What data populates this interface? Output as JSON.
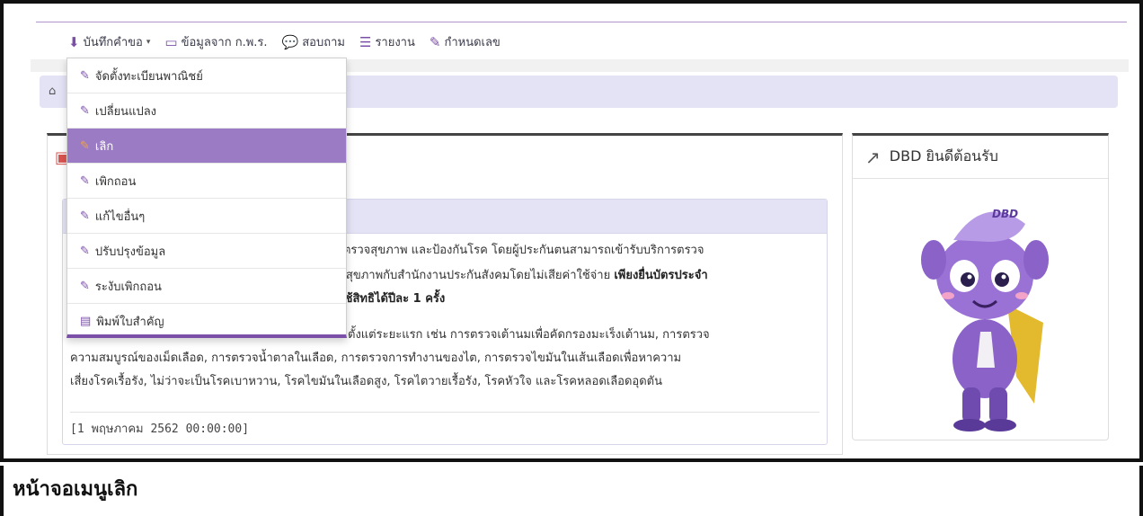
{
  "navbar": {
    "items": [
      {
        "icon": "download-icon",
        "glyph": "⬇",
        "label": "บันทึกคำขอ",
        "caret": "▾"
      },
      {
        "icon": "monitor-icon",
        "glyph": "▭",
        "label": "ข้อมูลจาก ก.พ.ร."
      },
      {
        "icon": "chat-icon",
        "glyph": "💬",
        "label": "สอบถาม"
      },
      {
        "icon": "document-icon",
        "glyph": "☰",
        "label": "รายงาน"
      },
      {
        "icon": "edit-icon",
        "glyph": "✎",
        "label": "กำหนดเลข"
      }
    ]
  },
  "breadcrumb": {
    "icon": "home-icon",
    "glyph": "⌂"
  },
  "dropdown": {
    "items": [
      {
        "label": "จัดตั้งทะเบียนพาณิชย์",
        "glyph": "✎",
        "active": false
      },
      {
        "label": "เปลี่ยนแปลง",
        "glyph": "✎",
        "active": false
      },
      {
        "label": "เลิก",
        "glyph": "✎",
        "active": true
      },
      {
        "label": "เพิกถอน",
        "glyph": "✎",
        "active": false
      },
      {
        "label": "แก้ไขอื่นๆ",
        "glyph": "✎",
        "active": false
      },
      {
        "label": "ปรับปรุงข้อมูล",
        "glyph": "✎",
        "active": false
      },
      {
        "label": "ระงับเพิกถอน",
        "glyph": "✎",
        "active": false
      },
      {
        "label": "พิมพ์ใบสำคัญ",
        "glyph": "▤",
        "active": false
      }
    ]
  },
  "news": {
    "line1": "อ ตรวจสุขภาพ และป้องกันโรค โดยผู้ประกันตนสามารถเข้ารับบริการตรวจ",
    "line2_normal": "วจสุขภาพกับสำนักงานประกันสังคมโดยไม่เสียค่าใช้จ่าย ",
    "line2_bold": "เพียงยื่นบัตรประจำ",
    "line3_bold": "าใช้สิทธิได้ปีละ 1 ครั้ง",
    "line4": "มัดตั้งแต่ระยะแรก เช่น การตรวจเต้านมเพื่อคัดกรองมะเร็งเต้านม, การตรวจ",
    "line5": "ความสมบูรณ์ของเม็ดเลือด, การตรวจน้ำตาลในเลือด, การตรวจการทำงานของไต, การตรวจไขมันในเส้นเลือดเพื่อหาความ",
    "line6": "เสี่ยงโรคเรื้อรัง, ไม่ว่าจะเป็นโรคเบาหวาน, โรคไขมันในเลือดสูง, โรคไตวายเรื้อรัง, โรคหัวใจ และโรคหลอดเลือดอุดตัน",
    "date": "[1 พฤษภาคม 2562 00:00:00]"
  },
  "right_panel": {
    "title": "DBD ยินดีต้อนรับ",
    "icon": "external-link-icon",
    "glyph": "↗",
    "badge": "DBD"
  },
  "caption": "หน้าจอเมนูเลิก",
  "colors": {
    "accent": "#7b4fa8",
    "active_item": "#9b7bc4",
    "band": "#e3e3f5"
  }
}
